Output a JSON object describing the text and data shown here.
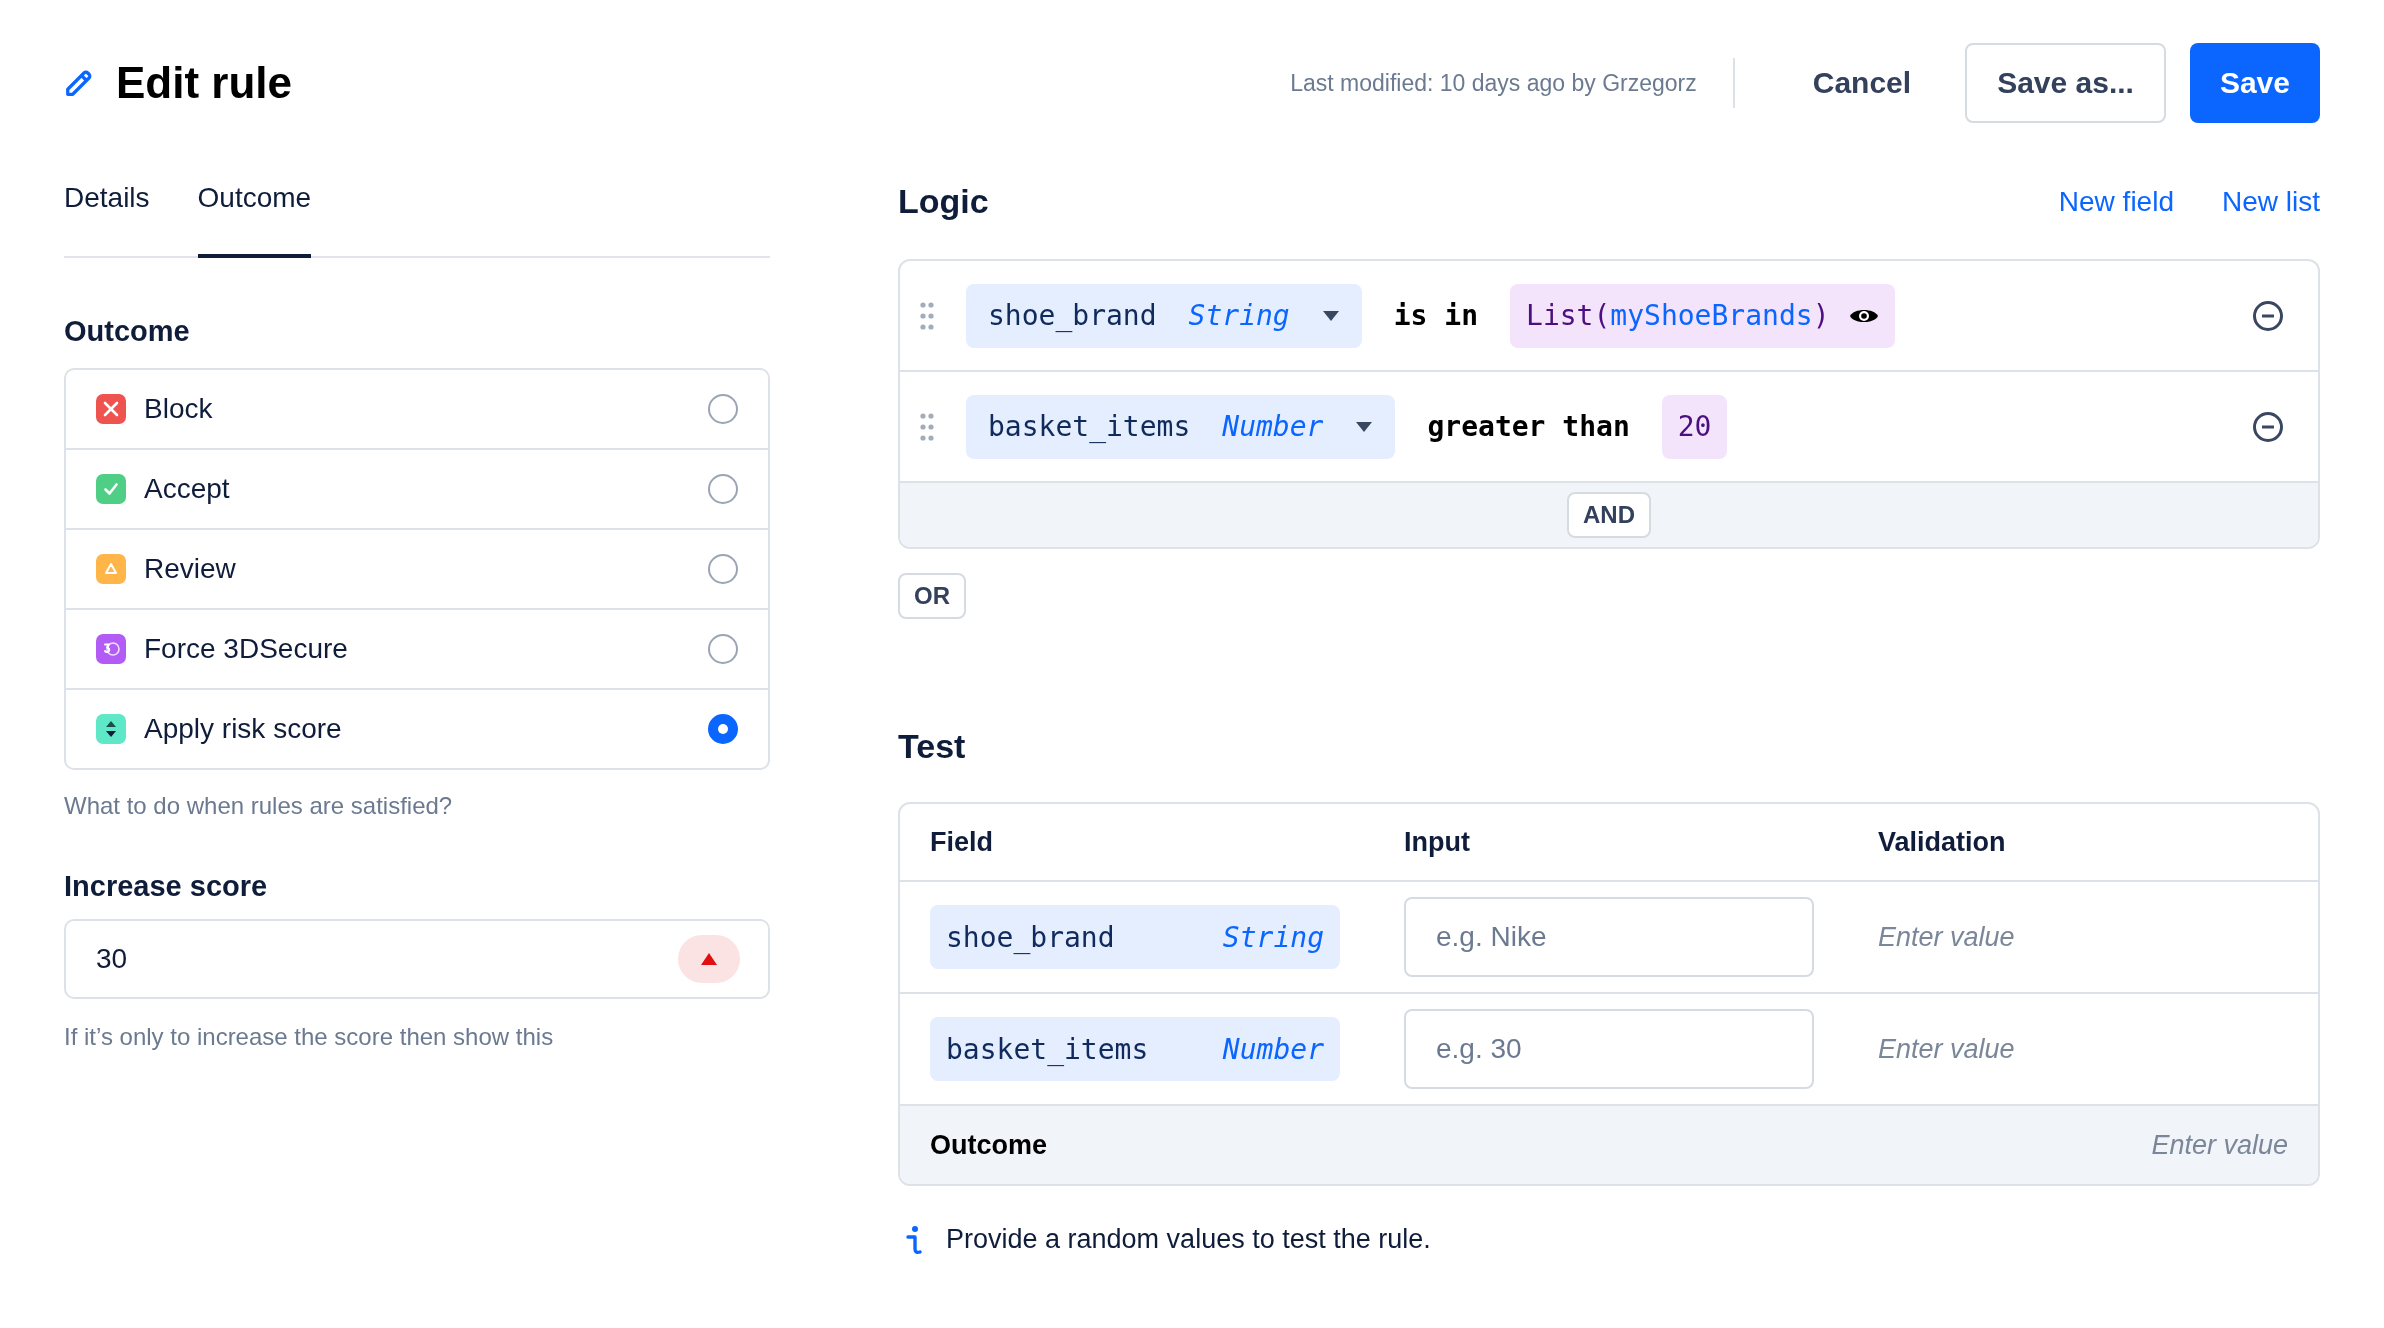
{
  "header": {
    "title": "Edit rule",
    "last_modified": "Last modified: 10 days ago by Grzegorz",
    "buttons": [
      {
        "label": "Cancel",
        "kind": "text"
      },
      {
        "label": "Save as...",
        "kind": "outline"
      },
      {
        "label": "Save",
        "kind": "primary"
      }
    ]
  },
  "tabs": [
    {
      "label": "Details",
      "selected": false
    },
    {
      "label": "Outcome",
      "selected": true
    }
  ],
  "outcome": {
    "heading": "Outcome",
    "options": [
      {
        "label": "Block",
        "kind": "block",
        "color": "#ef5350",
        "selected": false
      },
      {
        "label": "Accept",
        "kind": "accept",
        "color": "#4fcf86",
        "selected": false
      },
      {
        "label": "Review",
        "kind": "review",
        "color": "#ffb547",
        "selected": false
      },
      {
        "label": "Force 3DSecure",
        "kind": "secure",
        "color": "#b25cf5",
        "selected": false
      },
      {
        "label": "Apply risk score",
        "kind": "risk",
        "color": "#5ee8c8",
        "selected": true
      }
    ],
    "hint": "What to do when rules are satisfied?"
  },
  "increase_score": {
    "label": "Increase score",
    "value": "30",
    "hint": "If it’s only to increase the score then show this"
  },
  "logic": {
    "heading": "Logic",
    "links": [
      "New field",
      "New list"
    ],
    "conditions": [
      {
        "field": "shoe_brand",
        "type": "String",
        "operator": "is in",
        "kind": "list",
        "value_prefix": "List(",
        "value": "myShoeBrands",
        "value_suffix": ")"
      },
      {
        "field": "basket_items",
        "type": "Number",
        "operator": "greater than",
        "kind": "number",
        "value": "20"
      }
    ],
    "join": "AND",
    "or": "OR"
  },
  "test": {
    "heading": "Test",
    "columns": [
      "Field",
      "Input",
      "Validation"
    ],
    "rows": [
      {
        "field": "shoe_brand",
        "type": "String",
        "placeholder": "e.g. Nike",
        "validation": "Enter value"
      },
      {
        "field": "basket_items",
        "type": "Number",
        "placeholder": "e.g. 30",
        "validation": "Enter value"
      }
    ],
    "outcome": {
      "label": "Outcome",
      "value": "Enter value"
    },
    "info": "Provide a random values to test the rule."
  }
}
